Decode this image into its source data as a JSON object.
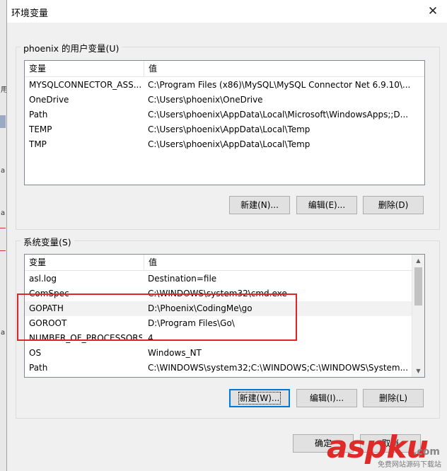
{
  "window": {
    "title": "环境变量",
    "close_glyph": "✕"
  },
  "user_vars": {
    "group_label": "phoenix 的用户变量(U)",
    "columns": [
      "变量",
      "值"
    ],
    "rows": [
      {
        "name": "MYSQLCONNECTOR_ASS...",
        "value": "C:\\Program Files (x86)\\MySQL\\MySQL Connector Net 6.9.10\\..."
      },
      {
        "name": "OneDrive",
        "value": "C:\\Users\\phoenix\\OneDrive"
      },
      {
        "name": "Path",
        "value": "C:\\Users\\phoenix\\AppData\\Local\\Microsoft\\WindowsApps;;D..."
      },
      {
        "name": "TEMP",
        "value": "C:\\Users\\phoenix\\AppData\\Local\\Temp"
      },
      {
        "name": "TMP",
        "value": "C:\\Users\\phoenix\\AppData\\Local\\Temp"
      }
    ],
    "buttons": {
      "new": "新建(N)...",
      "edit": "编辑(E)...",
      "delete": "删除(D)"
    }
  },
  "system_vars": {
    "group_label": "系统变量(S)",
    "columns": [
      "变量",
      "值"
    ],
    "rows": [
      {
        "name": "asl.log",
        "value": "Destination=file"
      },
      {
        "name": "ComSpec",
        "value": "C:\\WINDOWS\\system32\\cmd.exe"
      },
      {
        "name": "GOPATH",
        "value": "D:\\Phoenix\\CodingMe\\go"
      },
      {
        "name": "GOROOT",
        "value": "D:\\Program Files\\Go\\"
      },
      {
        "name": "NUMBER_OF_PROCESSORS",
        "value": "4"
      },
      {
        "name": "OS",
        "value": "Windows_NT"
      },
      {
        "name": "Path",
        "value": "C:\\WINDOWS\\system32;C:\\WINDOWS;C:\\WINDOWS\\System..."
      }
    ],
    "buttons": {
      "new": "新建(W)...",
      "edit": "编辑(I)...",
      "delete": "删除(L)"
    }
  },
  "footer": {
    "ok": "确定",
    "cancel": "取消"
  },
  "watermark": {
    "logo": "aspku",
    "domain": ".com",
    "subtitle": "免费网站源码下载站"
  },
  "background_app": {
    "labels": [
      "用",
      "a",
      "a",
      "a"
    ]
  },
  "colors": {
    "annotation": "#e0242b",
    "default_button_border": "#0078d7",
    "selected_row": "#f2f2f2"
  }
}
